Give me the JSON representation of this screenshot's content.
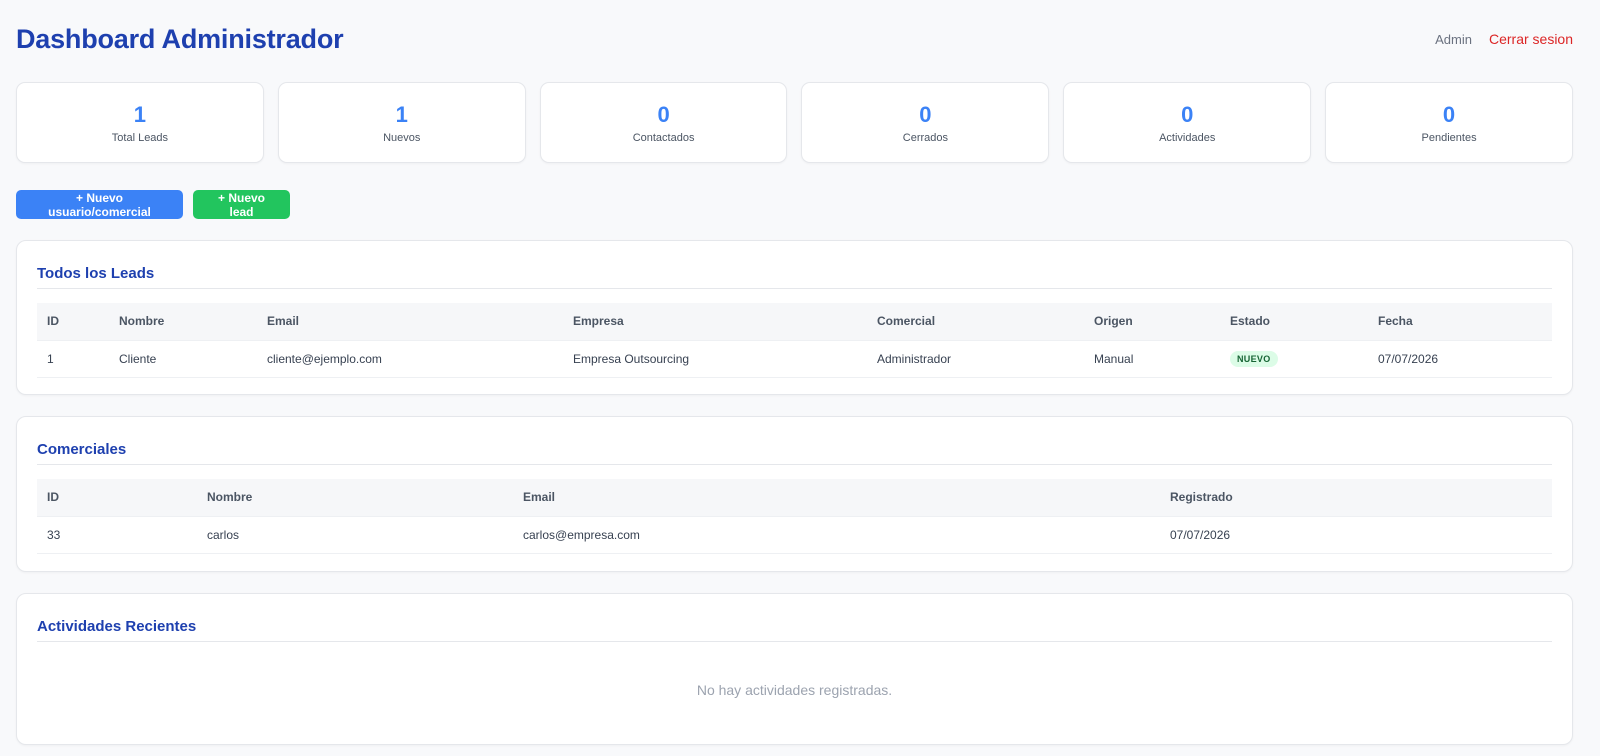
{
  "header": {
    "title": "Dashboard Administrador",
    "user_label": "Admin",
    "logout_label": "Cerrar sesion"
  },
  "stats": [
    {
      "value": "1",
      "label": "Total Leads"
    },
    {
      "value": "1",
      "label": "Nuevos"
    },
    {
      "value": "0",
      "label": "Contactados"
    },
    {
      "value": "0",
      "label": "Cerrados"
    },
    {
      "value": "0",
      "label": "Actividades"
    },
    {
      "value": "0",
      "label": "Pendientes"
    }
  ],
  "actions": {
    "new_user_label": "+ Nuevo usuario/comercial",
    "new_lead_label": "+ Nuevo lead"
  },
  "leads": {
    "title": "Todos los Leads",
    "columns": [
      "ID",
      "Nombre",
      "Email",
      "Empresa",
      "Comercial",
      "Origen",
      "Estado",
      "Fecha"
    ],
    "rows": [
      {
        "id": "1",
        "nombre": "Cliente",
        "email": "cliente@ejemplo.com",
        "empresa": "Empresa Outsourcing",
        "comercial": "Administrador",
        "origen": "Manual",
        "estado": "NUEVO",
        "fecha": "07/07/2026"
      }
    ]
  },
  "comerciales": {
    "title": "Comerciales",
    "columns": [
      "ID",
      "Nombre",
      "Email",
      "Registrado"
    ],
    "rows": [
      {
        "id": "33",
        "nombre": "carlos",
        "email": "carlos@empresa.com",
        "registrado": "07/07/2026"
      }
    ]
  },
  "actividades": {
    "title": "Actividades Recientes",
    "empty_message": "No hay actividades registradas."
  },
  "colors": {
    "title_blue": "#1e40af",
    "accent_blue": "#3b82f6",
    "success_green": "#22c55e",
    "danger_red": "#dc2626",
    "badge_bg": "#dcfce7",
    "badge_text": "#166534"
  }
}
